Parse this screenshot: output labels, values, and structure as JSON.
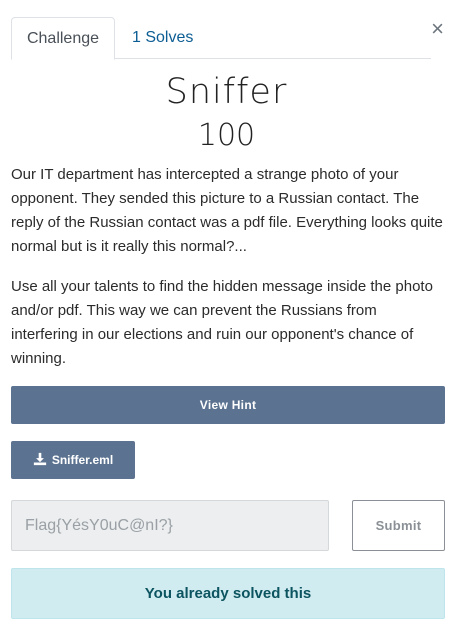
{
  "tabs": [
    {
      "label": "Challenge"
    },
    {
      "label": "1 Solves"
    }
  ],
  "close_label": "×",
  "challenge": {
    "name": "Sniffer",
    "value": "100",
    "description": [
      "Our IT department has intercepted a strange photo of your opponent. They sended this picture to a Russian contact. The reply of the Russian contact was a pdf file. Everything looks quite normal but is it really this normal?...",
      "Use all your talents to find the hidden message inside the photo and/or pdf. This way we can prevent the Russians from interfering in our elections and ruin our opponent's chance of winning."
    ]
  },
  "hint_button": "View Hint",
  "file": {
    "label": "Sniffer.eml",
    "icon": "download-icon"
  },
  "flag_input": {
    "placeholder": "Flag{YésY0uC@nI?}",
    "value": ""
  },
  "submit_button": "Submit",
  "status_message": "You already solved this",
  "colors": {
    "button_bg": "#5b7290",
    "link": "#0c5d93",
    "solved_bg": "#d1ecf1",
    "solved_text": "#0c5460"
  }
}
